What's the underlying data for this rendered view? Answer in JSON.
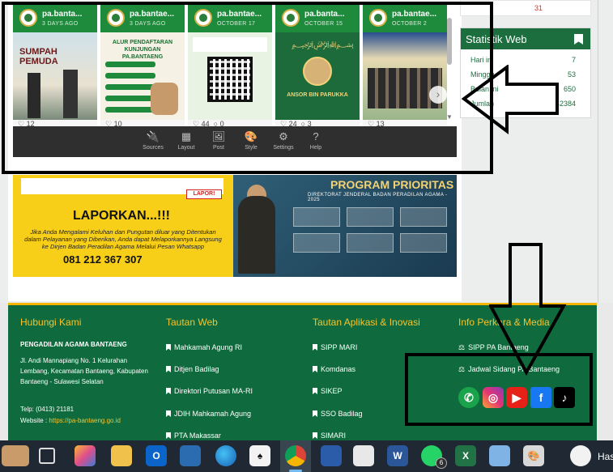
{
  "feed": {
    "posts": [
      {
        "user": "pa.banta...",
        "date": "3 DAYS AGO",
        "image_text": "SUMPAH PEMUDA",
        "likes": "12",
        "comments": ""
      },
      {
        "user": "pa.bantae...",
        "date": "3 DAYS AGO",
        "image_text": "ALUR PENDAFTARAN KUNJUNGAN PA.BANTAENG",
        "likes": "10",
        "comments": ""
      },
      {
        "user": "pa.bantae...",
        "date": "OCTOBER 17",
        "image_text": "",
        "likes": "44",
        "comments": "0"
      },
      {
        "user": "pa.banta...",
        "date": "OCTOBER 15",
        "image_text": "ANSOR BIN PARUKKA",
        "likes": "24",
        "comments": "3"
      },
      {
        "user": "pa.bantae...",
        "date": "OCTOBER 2",
        "image_text": "",
        "likes": "13",
        "comments": ""
      }
    ],
    "next_arrow": "›",
    "scroll_down": "▼"
  },
  "editor_toolbar": {
    "items": [
      {
        "label": "Sources",
        "icon": "plug-icon",
        "glyph": "🔌"
      },
      {
        "label": "Layout",
        "icon": "layout-icon",
        "glyph": "▦"
      },
      {
        "label": "Post",
        "icon": "image-icon",
        "glyph": "🖼"
      },
      {
        "label": "Style",
        "icon": "palette-icon",
        "glyph": "🎨"
      },
      {
        "label": "Settings",
        "icon": "gear-icon",
        "glyph": "⚙"
      },
      {
        "label": "Help",
        "icon": "help-icon",
        "glyph": "?"
      }
    ]
  },
  "banner": {
    "lapor_logo": "LAPOR!",
    "lapor_title": "LAPORKAN...!!!",
    "lapor_body": "Jika Anda Mengalami Keluhan dan Pungutan diluar yang Ditentukan dalam Pelayanan yang Diberikan, Anda dapat Melaporkannya Langsung ke Dirjen Badan Peradilan Agama Melalui Pesan Whatsapp",
    "lapor_phone": "081 212 367 307",
    "program_title": "PROGRAM PRIORITAS",
    "program_subtitle": "DIREKTORAT JENDERAL BADAN PERADILAN AGAMA - 2025"
  },
  "sidebar": {
    "calendar_date": "31",
    "stats": {
      "title": "Statistik Web",
      "rows": [
        {
          "label": "Hari ini",
          "value": "7"
        },
        {
          "label": "Minggu",
          "value": "53"
        },
        {
          "label": "Bulan ini",
          "value": "650"
        },
        {
          "label": "Jumlah",
          "value": "42384"
        }
      ]
    }
  },
  "footer": {
    "hubungi": {
      "title": "Hubungi Kami",
      "org": "PENGADILAN AGAMA BANTAENG",
      "address": "Jl. Andi Mannapiang No. 1 Kelurahan Lembang, Kecamatan Bantaeng, Kabupaten Bantaeng - Sulawesi Selatan",
      "phone": "Telp: (0413) 21181",
      "website_label": "Website : ",
      "website": "https://pa-bantaeng.go.id"
    },
    "tautan_web": {
      "title": "Tautan Web",
      "links": [
        "Mahkamah Agung RI",
        "Ditjen Badilag",
        "Direktori Putusan MA-RI",
        "JDIH Mahkamah Agung",
        "PTA Makassar"
      ]
    },
    "tautan_aplikasi": {
      "title": "Tautan Aplikasi & Inovasi",
      "links": [
        "SIPP MARI",
        "Komdanas",
        "SIKEP",
        "SSO Badilag",
        "SIMARI"
      ]
    },
    "info_perkara": {
      "title": "Info Perkara & Media",
      "links": [
        "SIPP PA Bantaeng",
        "Jadwal Sidang PA Bantaeng"
      ]
    },
    "social": [
      {
        "name": "whatsapp-icon",
        "glyph": "✆"
      },
      {
        "name": "instagram-icon",
        "glyph": "◎"
      },
      {
        "name": "youtube-icon",
        "glyph": "▶"
      },
      {
        "name": "facebook-icon",
        "glyph": "f"
      },
      {
        "name": "tiktok-icon",
        "glyph": "♪"
      }
    ]
  },
  "taskbar": {
    "whatsapp_badge": "6",
    "truncated_label": "Has"
  },
  "colors": {
    "footer_green": "#0f6b3d",
    "accent_gold": "#f4c430",
    "widget_green": "#1d6e3f",
    "feed_header_green": "#1e8a3c",
    "annotation": "#000000"
  }
}
